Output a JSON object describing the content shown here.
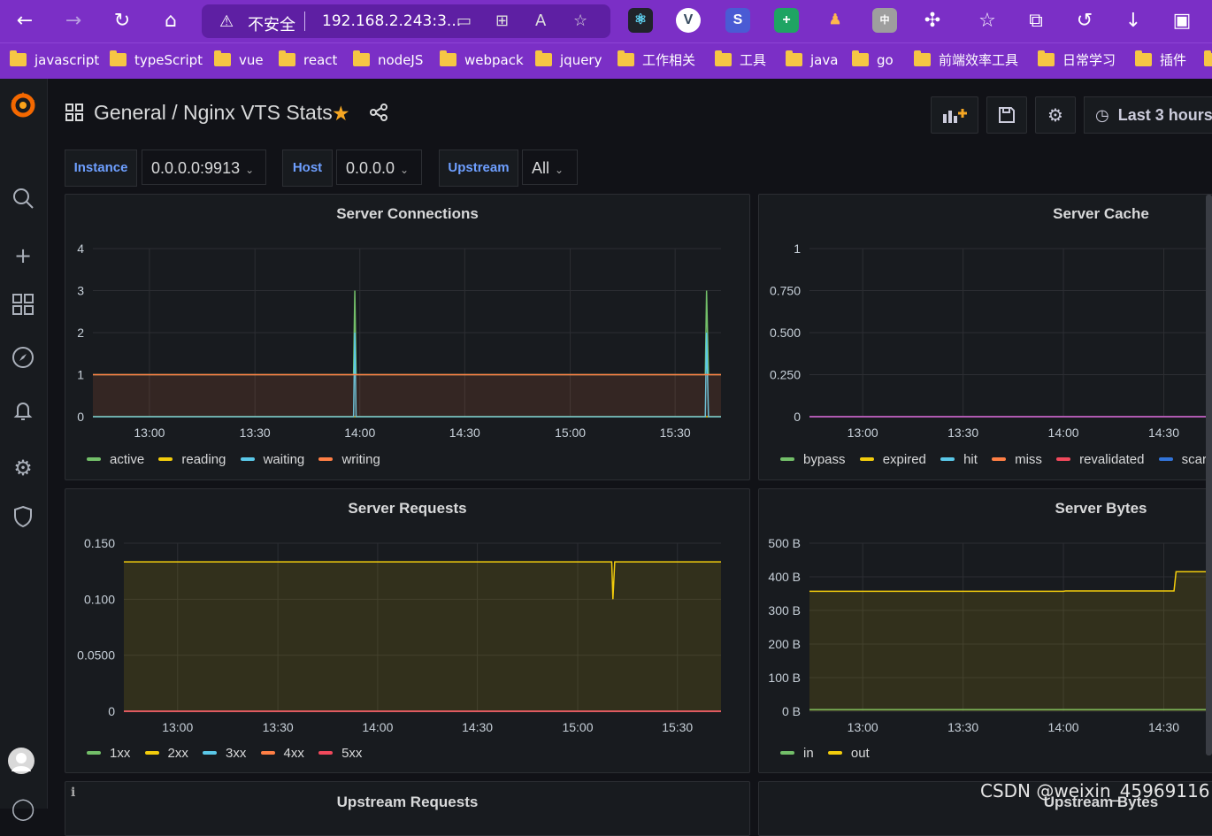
{
  "browser": {
    "address": {
      "security_label": "不安全",
      "url": "192.168.2.243:3..."
    },
    "bookmarks": [
      "javascript",
      "typeScript",
      "vue",
      "react",
      "nodeJS",
      "webpack",
      "jquery",
      "工作相关",
      "工具",
      "java",
      "go",
      "前端效率工具",
      "日常学习",
      "插件"
    ]
  },
  "header": {
    "folder": "General",
    "separator": "/",
    "title": "Nginx VTS Stats",
    "time_range": "Last 3 hours"
  },
  "variables": [
    {
      "label": "Instance",
      "value": "0.0.0.0:9913"
    },
    {
      "label": "Host",
      "value": "0.0.0.0"
    },
    {
      "label": "Upstream",
      "value": "All"
    }
  ],
  "panels": {
    "connections": {
      "title": "Server Connections",
      "legend": [
        "active",
        "reading",
        "waiting",
        "writing"
      ]
    },
    "cache": {
      "title": "Server Cache",
      "legend": [
        "bypass",
        "expired",
        "hit",
        "miss",
        "revalidated",
        "scar"
      ]
    },
    "requests": {
      "title": "Server Requests",
      "legend": [
        "1xx",
        "2xx",
        "3xx",
        "4xx",
        "5xx"
      ]
    },
    "bytes": {
      "title": "Server Bytes",
      "legend": [
        "in",
        "out"
      ]
    },
    "upstream_requests": {
      "title": "Upstream Requests"
    },
    "upstream_bytes": {
      "title": "Upstream Bytes"
    }
  },
  "watermark": "CSDN @weixin_45969116",
  "colors": {
    "green": "#73bf69",
    "yellow": "#f2cc0c",
    "cyan": "#5ac8e8",
    "orange": "#ff9830",
    "red": "#f2495c",
    "blue": "#3274d9",
    "purple": "#a352cc"
  },
  "chart_data": [
    {
      "type": "line",
      "title": "Server Connections",
      "x_ticks": [
        "13:00",
        "13:30",
        "14:00",
        "14:30",
        "15:00",
        "15:30"
      ],
      "ylim": [
        0,
        4
      ],
      "y_ticks": [
        "0",
        "1",
        "2",
        "3",
        "4"
      ],
      "series": [
        {
          "name": "active",
          "values": [
            [
              0,
              1
            ],
            [
              0.415,
              1
            ],
            [
              0.417,
              3
            ],
            [
              0.419,
              1
            ],
            [
              0.975,
              1
            ],
            [
              0.977,
              3
            ],
            [
              0.98,
              1
            ],
            [
              1,
              1
            ]
          ]
        },
        {
          "name": "reading",
          "values": [
            [
              0,
              0
            ],
            [
              1,
              0
            ]
          ]
        },
        {
          "name": "waiting",
          "values": [
            [
              0,
              0
            ],
            [
              0.415,
              0
            ],
            [
              0.417,
              2
            ],
            [
              0.419,
              0
            ],
            [
              0.975,
              0
            ],
            [
              0.977,
              2
            ],
            [
              0.98,
              0
            ],
            [
              1,
              0
            ]
          ]
        },
        {
          "name": "writing",
          "values": [
            [
              0,
              1
            ],
            [
              1,
              1
            ]
          ]
        }
      ]
    },
    {
      "type": "line",
      "title": "Server Cache",
      "x_ticks": [
        "13:00",
        "13:30",
        "14:00",
        "14:30"
      ],
      "ylim": [
        0,
        1
      ],
      "y_ticks": [
        "0",
        "0.250",
        "0.500",
        "0.750",
        "1"
      ],
      "series": [
        {
          "name": "bypass",
          "values": [
            [
              0,
              0
            ],
            [
              1,
              0
            ]
          ]
        },
        {
          "name": "expired",
          "values": [
            [
              0,
              0
            ],
            [
              1,
              0
            ]
          ]
        },
        {
          "name": "hit",
          "values": [
            [
              0,
              0
            ],
            [
              1,
              0
            ]
          ]
        },
        {
          "name": "miss",
          "values": [
            [
              0,
              0
            ],
            [
              1,
              0
            ]
          ]
        },
        {
          "name": "revalidated",
          "values": [
            [
              0,
              0
            ],
            [
              1,
              0
            ]
          ]
        },
        {
          "name": "scar",
          "values": [
            [
              0,
              0
            ],
            [
              1,
              0
            ]
          ]
        }
      ]
    },
    {
      "type": "line",
      "title": "Server Requests",
      "x_ticks": [
        "13:00",
        "13:30",
        "14:00",
        "14:30",
        "15:00",
        "15:30"
      ],
      "ylim": [
        0,
        0.15
      ],
      "y_ticks": [
        "0",
        "0.0500",
        "0.100",
        "0.150"
      ],
      "series": [
        {
          "name": "1xx",
          "values": [
            [
              0,
              0
            ],
            [
              1,
              0
            ]
          ]
        },
        {
          "name": "2xx",
          "values": [
            [
              0,
              0.1333
            ],
            [
              0.817,
              0.1333
            ],
            [
              0.819,
              0.1
            ],
            [
              0.822,
              0.1333
            ],
            [
              1,
              0.1333
            ]
          ]
        },
        {
          "name": "3xx",
          "values": [
            [
              0,
              0
            ],
            [
              1,
              0
            ]
          ]
        },
        {
          "name": "4xx",
          "values": [
            [
              0,
              0
            ],
            [
              1,
              0
            ]
          ]
        },
        {
          "name": "5xx",
          "values": [
            [
              0,
              0
            ],
            [
              1,
              0
            ]
          ]
        }
      ]
    },
    {
      "type": "line",
      "title": "Server Bytes",
      "x_ticks": [
        "13:00",
        "13:30",
        "14:00",
        "14:30"
      ],
      "ylim": [
        0,
        500
      ],
      "y_ticks": [
        "0 B",
        "100 B",
        "200 B",
        "300 B",
        "400 B",
        "500 B"
      ],
      "series": [
        {
          "name": "in",
          "values": [
            [
              0,
              5
            ],
            [
              1,
              5
            ]
          ]
        },
        {
          "name": "out",
          "values": [
            [
              0,
              357
            ],
            [
              0.62,
              357
            ],
            [
              0.625,
              358
            ],
            [
              0.89,
              358
            ],
            [
              0.895,
              415
            ],
            [
              1,
              415
            ]
          ]
        }
      ]
    }
  ]
}
